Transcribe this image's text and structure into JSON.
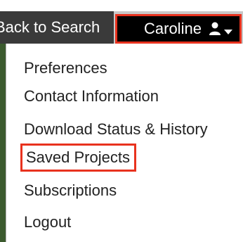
{
  "nav": {
    "back_label": "Back to Search",
    "user_name": "Caroline"
  },
  "menu": {
    "items": [
      {
        "label": "Preferences"
      },
      {
        "label": "Contact Information"
      },
      {
        "label": "Download Status & History"
      },
      {
        "label": "Saved Projects",
        "highlighted": true
      },
      {
        "label": "Subscriptions"
      },
      {
        "label": "Logout"
      }
    ]
  },
  "colors": {
    "highlight": "#e8321e",
    "nav_dark": "#000000",
    "back_bg": "#3a3a3a"
  },
  "icons": {
    "user": "user-icon",
    "caret": "caret-down-icon"
  }
}
